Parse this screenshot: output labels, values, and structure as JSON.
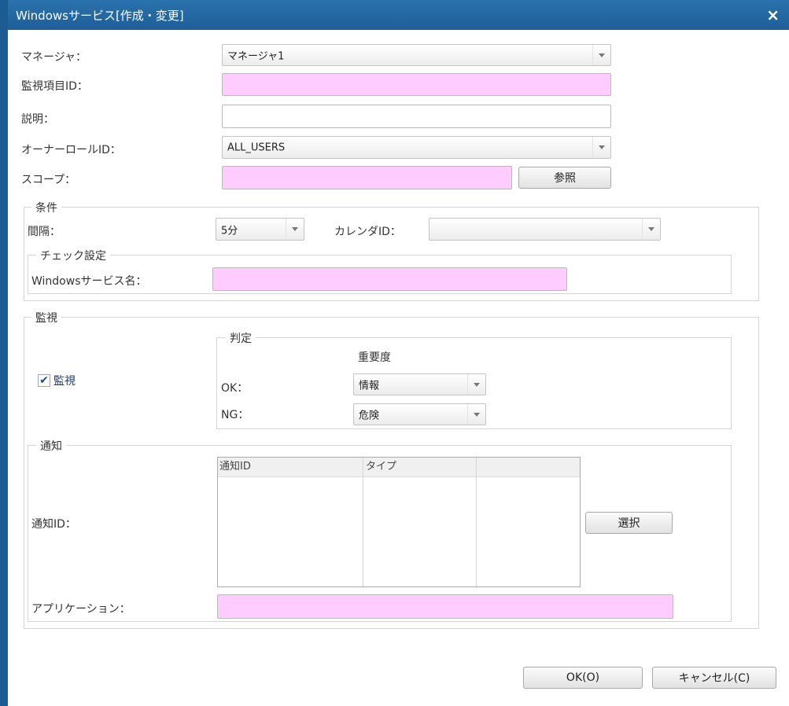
{
  "dialog": {
    "title": "Windowsサービス[作成・変更]",
    "close_symbol": "×"
  },
  "fields": {
    "manager_label": "マネージャ：",
    "manager_value": "マネージャ1",
    "monitor_item_id_label": "監視項目ID：",
    "description_label": "説明：",
    "owner_role_label": "オーナーロールID：",
    "owner_role_value": "ALL_USERS",
    "scope_label": "スコープ：",
    "browse_button": "参照"
  },
  "condition": {
    "legend": "条件",
    "interval_label": "間隔：",
    "interval_value": "5分",
    "calendar_label": "カレンダID：",
    "calendar_value": "",
    "check_legend": "チェック設定",
    "service_name_label": "Windowsサービス名："
  },
  "monitor": {
    "legend": "監視",
    "monitor_checkbox_label": "監視",
    "monitor_checked": true,
    "judgment_legend": "判定",
    "importance_header": "重要度",
    "ok_label": "OK：",
    "ok_value": "情報",
    "ng_label": "NG：",
    "ng_value": "危険"
  },
  "notify": {
    "legend": "通知",
    "notify_id_label": "通知ID：",
    "columns": [
      "通知ID",
      "タイプ",
      ""
    ],
    "select_button": "選択",
    "application_label": "アプリケーション："
  },
  "footer": {
    "ok_button": "OK(O)",
    "cancel_button": "キャンセル(C)"
  },
  "colors": {
    "title_bar": "#1e5f98",
    "required_field": "#ffccff"
  },
  "icons": {
    "close": "close-icon",
    "dropdown": "chevron-down-icon",
    "checkbox": "checkmark-icon"
  }
}
